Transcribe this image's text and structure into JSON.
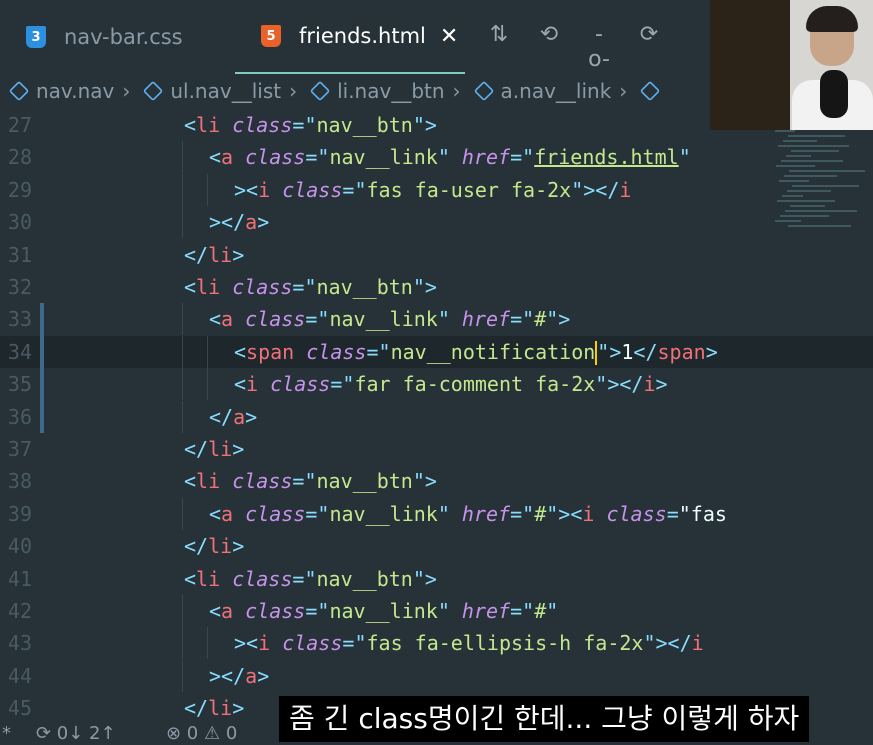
{
  "tabs": [
    {
      "label": "nav-bar.css",
      "icon": "css3-file-icon",
      "active": false
    },
    {
      "label": "friends.html",
      "icon": "html5-file-icon",
      "active": true,
      "close": "✕"
    }
  ],
  "file_badges": {
    "css": "3",
    "html": "5"
  },
  "toolbar": {
    "compare_glyph": "⇅",
    "back_glyph": "⟲",
    "dot_glyph": "-o-",
    "forward_glyph": "⟳"
  },
  "breadcrumb": [
    "nav.nav",
    "ul.nav__list",
    "li.nav__btn",
    "a.nav__link"
  ],
  "breadcrumb_sep": "›",
  "editor": {
    "current_line": 34,
    "lines": [
      {
        "n": 27,
        "indent": 4,
        "html": "<li class=\"nav__btn\">"
      },
      {
        "n": 28,
        "indent": 5,
        "html": "<a class=\"nav__link\" href=\"friends.html\""
      },
      {
        "n": 29,
        "indent": 6,
        "html": "><i class=\"fas fa-user fa-2x\"></i"
      },
      {
        "n": 30,
        "indent": 5,
        "html": "></a>"
      },
      {
        "n": 31,
        "indent": 4,
        "html": "</li>"
      },
      {
        "n": 32,
        "indent": 4,
        "html": "<li class=\"nav__btn\">"
      },
      {
        "n": 33,
        "indent": 5,
        "html": "<a class=\"nav__link\" href=\"#\">"
      },
      {
        "n": 34,
        "indent": 6,
        "html": "<span class=\"nav__notification\">1</span>"
      },
      {
        "n": 35,
        "indent": 6,
        "html": "<i class=\"far fa-comment fa-2x\"></i>"
      },
      {
        "n": 36,
        "indent": 5,
        "html": "</a>"
      },
      {
        "n": 37,
        "indent": 4,
        "html": "</li>"
      },
      {
        "n": 38,
        "indent": 4,
        "html": "<li class=\"nav__btn\">"
      },
      {
        "n": 39,
        "indent": 5,
        "html": "<a class=\"nav__link\" href=\"#\"><i class=\"fas"
      },
      {
        "n": 40,
        "indent": 4,
        "html": "</li>"
      },
      {
        "n": 41,
        "indent": 4,
        "html": "<li class=\"nav__btn\">"
      },
      {
        "n": 42,
        "indent": 5,
        "html": "<a class=\"nav__link\" href=\"#\""
      },
      {
        "n": 43,
        "indent": 6,
        "html": "><i class=\"fas fa-ellipsis-h fa-2x\"></i"
      },
      {
        "n": 44,
        "indent": 5,
        "html": "></a>"
      },
      {
        "n": 45,
        "indent": 4,
        "html": "</li>"
      }
    ]
  },
  "subtitle": "좀 긴 class명이긴 한데... 그냥 이렇게 하자",
  "statusbar": {
    "sync": "⟳ 0↓ 2↑",
    "problems": "⊗ 0 ⚠ 0",
    "star": "*"
  },
  "colors": {
    "tag": "#f07178",
    "attr": "#c792ea",
    "string": "#c3e88d",
    "punct": "#89ddff",
    "cursor": "#ffcc00",
    "background": "#263238"
  }
}
